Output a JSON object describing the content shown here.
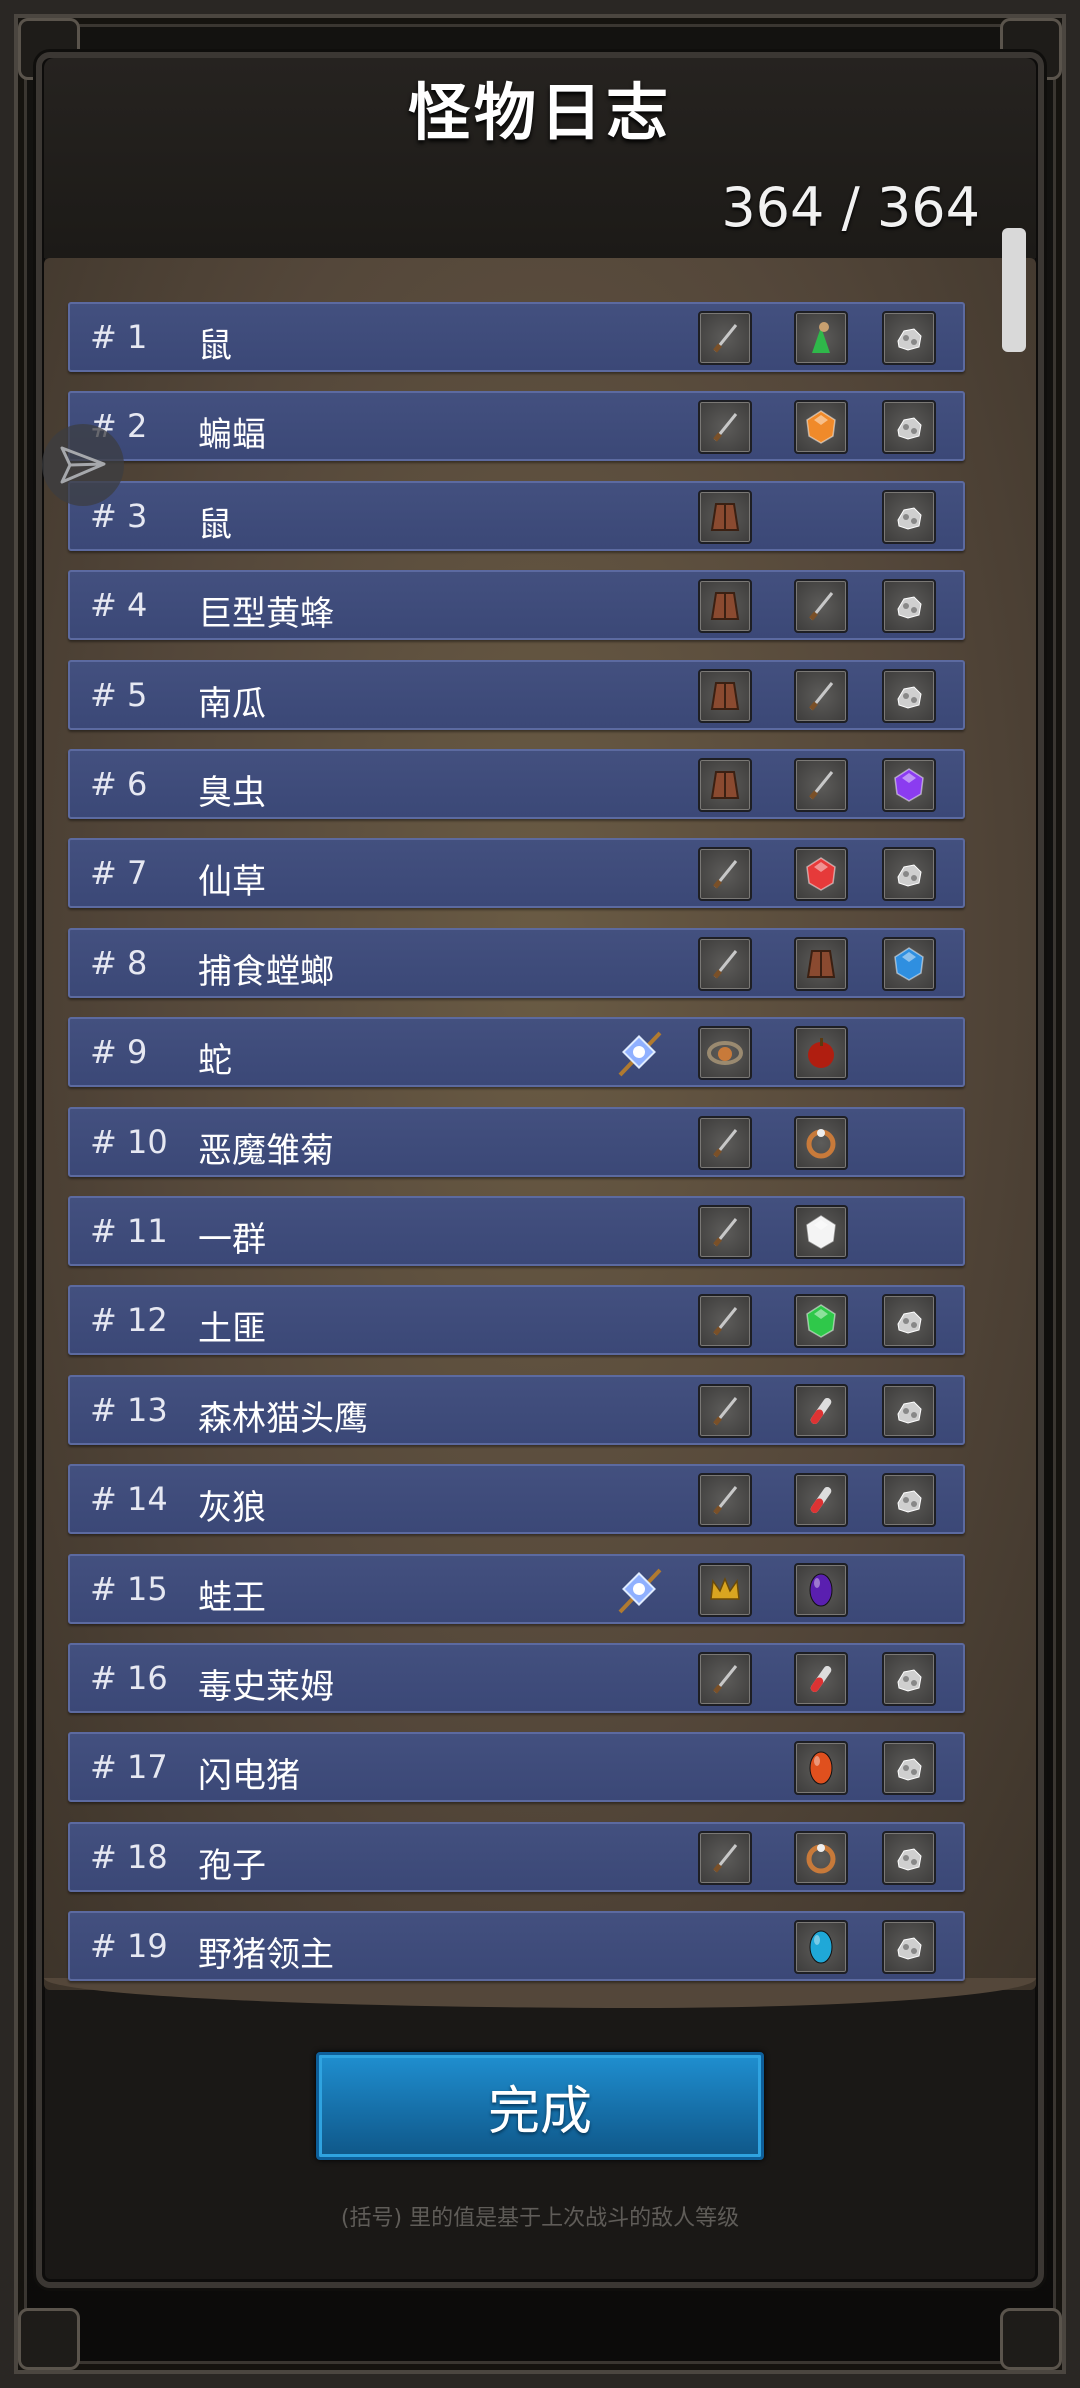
{
  "header": {
    "title": "怪物日志",
    "counter": "364 / 364"
  },
  "monsters": [
    {
      "num": "# 1",
      "name": "鼠",
      "items": [
        "staff-icon",
        "herb-icon",
        "ore-icon"
      ]
    },
    {
      "num": "# 2",
      "name": "蝙蝠",
      "items": [
        "mace-icon",
        "orange-gem-icon",
        "ore-icon"
      ]
    },
    {
      "num": "# 3",
      "name": "鼠",
      "items": [
        "belt-icon",
        "",
        "ore-icon"
      ]
    },
    {
      "num": "# 4",
      "name": "巨型黄蜂",
      "items": [
        "bracer-icon",
        "hammer-icon",
        "ore-icon"
      ]
    },
    {
      "num": "# 5",
      "name": "南瓜",
      "items": [
        "robe-icon",
        "chisel-icon",
        "ore-icon"
      ]
    },
    {
      "num": "# 6",
      "name": "臭虫",
      "items": [
        "armor-icon",
        "axe-icon",
        "purple-gem-icon"
      ]
    },
    {
      "num": "# 7",
      "name": "仙草",
      "items": [
        "spear-icon",
        "red-gem-icon",
        "ore-icon"
      ]
    },
    {
      "num": "# 8",
      "name": "捕食螳螂",
      "items": [
        "spear-icon",
        "hood-icon",
        "blue-gem-icon"
      ]
    },
    {
      "num": "# 9",
      "name": "蛇",
      "bonus": true,
      "items": [
        "amulet-icon",
        "apple-icon",
        ""
      ]
    },
    {
      "num": "# 10",
      "name": "恶魔雏菊",
      "items": [
        "axe-icon",
        "ring-icon",
        ""
      ]
    },
    {
      "num": "# 11",
      "name": "一群",
      "items": [
        "axe-icon",
        "white-gem-icon",
        ""
      ]
    },
    {
      "num": "# 12",
      "name": "土匪",
      "items": [
        "dagger-icon",
        "green-gem-icon",
        "ore-icon"
      ]
    },
    {
      "num": "# 13",
      "name": "森林猫头鹰",
      "items": [
        "staff-icon",
        "red-potion-icon",
        "ore-icon"
      ]
    },
    {
      "num": "# 14",
      "name": "灰狼",
      "items": [
        "scythe-icon",
        "blue-potion-icon",
        "ore-icon"
      ]
    },
    {
      "num": "# 15",
      "name": "蛙王",
      "bonus": true,
      "items": [
        "crown-icon",
        "purple-stone-icon",
        ""
      ]
    },
    {
      "num": "# 16",
      "name": "毒史莱姆",
      "items": [
        "sickle-icon",
        "purple-potion-icon",
        "ore-icon"
      ]
    },
    {
      "num": "# 17",
      "name": "闪电猪",
      "items": [
        "",
        "fire-stone-icon",
        "ore-icon"
      ]
    },
    {
      "num": "# 18",
      "name": "孢子",
      "items": [
        "spear-icon",
        "copper-ring-icon",
        "ore-icon"
      ]
    },
    {
      "num": "# 19",
      "name": "野猪领主",
      "items": [
        "",
        "aqua-stone-icon",
        "ore-icon"
      ]
    }
  ],
  "colors": {
    "row": "#3f4c7b",
    "button": "#1a7fbf",
    "orange-gem-icon": "#f08a2a",
    "purple-gem-icon": "#8b3cf0",
    "red-gem-icon": "#e63a3a",
    "blue-gem-icon": "#2f8fe0",
    "white-gem-icon": "#f4f4f4",
    "green-gem-icon": "#2fc84a",
    "purple-stone-icon": "#5a1fb0",
    "fire-stone-icon": "#e0501e",
    "aqua-stone-icon": "#1fa8d8"
  },
  "done_button": "完成",
  "footnote": "(括号) 里的值是基于上次战斗的敌人等级"
}
